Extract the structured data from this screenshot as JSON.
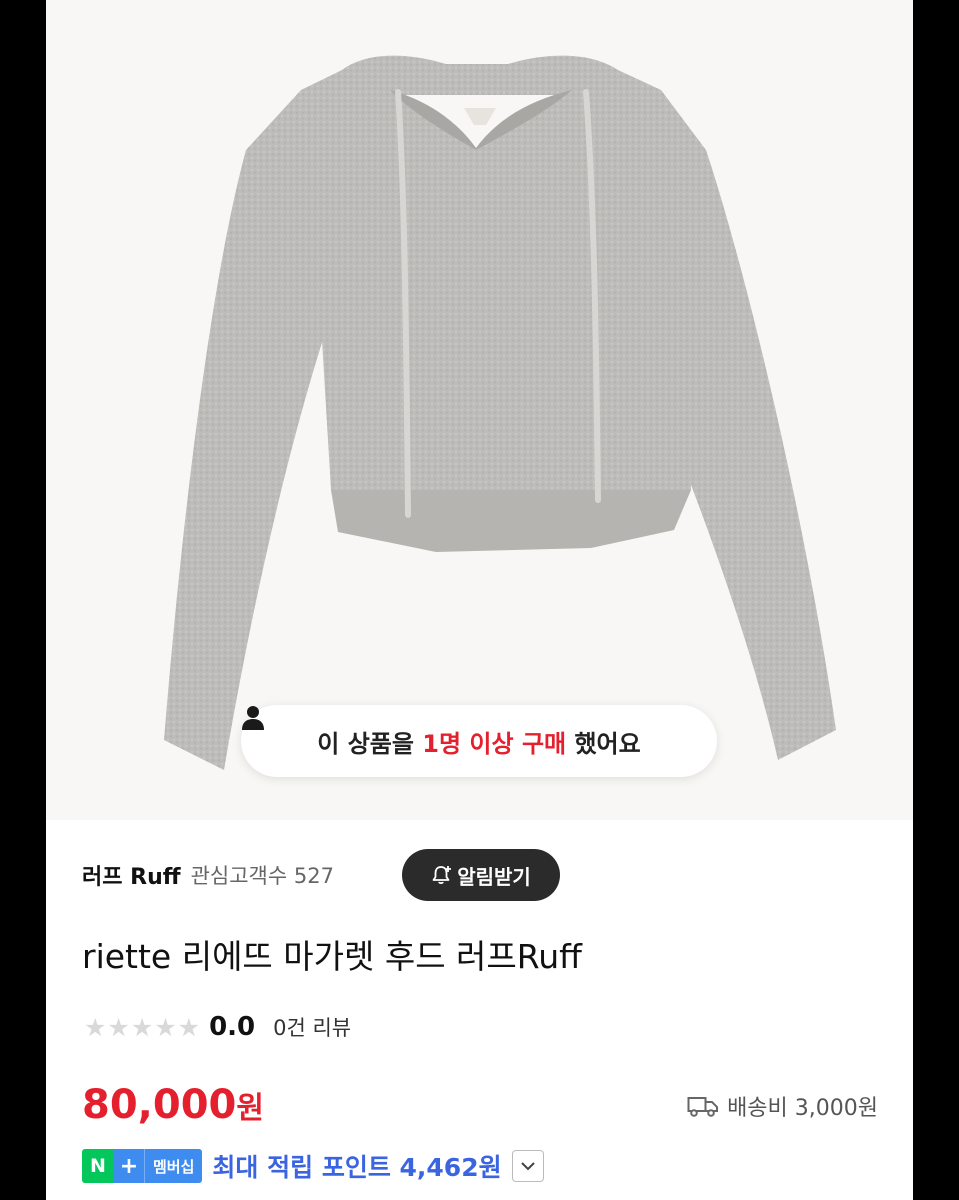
{
  "hero": {
    "buyers_prefix": "이 상품을 ",
    "buyers_count": "1명 이상 구매",
    "buyers_suffix": " 했어요"
  },
  "seller": {
    "name": "러프 Ruff",
    "interest_label": "관심고객수 527",
    "alarm_button": "알림받기"
  },
  "product": {
    "title": "riette 리에뜨 마가렛 후드 러프Ruff",
    "stars": "★★★★★",
    "rating": "0.0",
    "review_count": "0건 리뷰",
    "price_number": "80,000",
    "price_unit": "원",
    "shipping": "배송비 3,000원"
  },
  "membership": {
    "n_label": "N",
    "plus_label": "+",
    "badge_text": "멤버십",
    "points_text": "최대 적립 포인트 4,462원"
  },
  "colors": {
    "accent_red": "#e5202e",
    "point_blue": "#3a64e0",
    "naver_green": "#03c75a"
  }
}
